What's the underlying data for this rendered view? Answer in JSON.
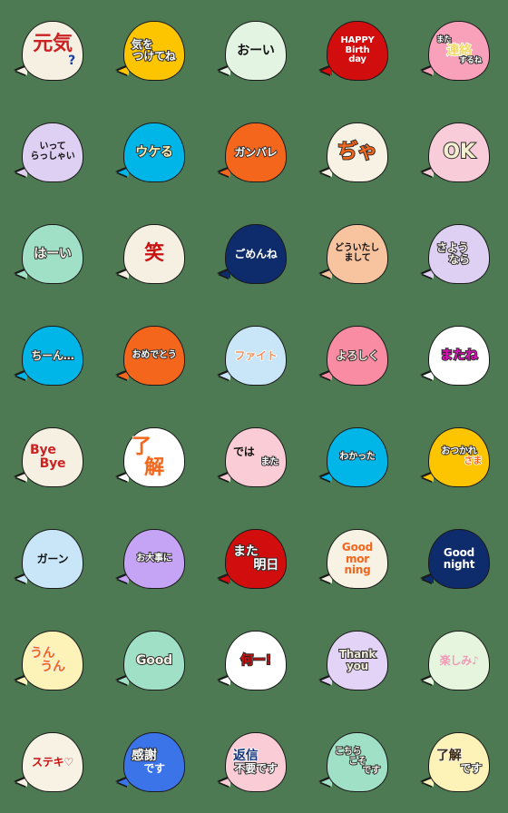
{
  "app": {
    "title": "Speech Bubble Emoji Sticker Sheet",
    "background_color": "#4d7a52",
    "columns": 5,
    "rows": 8
  },
  "stickers": [
    {
      "id": "genki",
      "name": "genki-question",
      "bubble_color": "#f5f0e1",
      "outline": "#1a1a1a",
      "lines": [
        {
          "text": "元気",
          "color": "#cc2222",
          "size": "sz-xl",
          "stroke": "stroke-light"
        },
        {
          "text": "?",
          "color": "#1a3fa0",
          "size": "sz-lg",
          "stroke": "stroke-light",
          "align": "align-r"
        }
      ]
    },
    {
      "id": "kiwotsukete",
      "name": "kiwotsuketene",
      "bubble_color": "#fdc500",
      "outline": "#1a1a1a",
      "lines": [
        {
          "text": "気を",
          "color": "#ffffff",
          "size": "sz-md",
          "stroke": "stroke-dark",
          "align": "align-l"
        },
        {
          "text": "つけてね",
          "color": "#ffffff",
          "size": "sz-md",
          "stroke": "stroke-dark"
        }
      ]
    },
    {
      "id": "ooi",
      "name": "ooi",
      "bubble_color": "#e3f5e2",
      "outline": "#1a1a1a",
      "lines": [
        {
          "text": "おーい",
          "color": "#111111",
          "size": "sz-lg",
          "stroke": "none"
        }
      ]
    },
    {
      "id": "happybirthday",
      "name": "happy-birthday",
      "bubble_color": "#d10d0d",
      "outline": "#1a1a1a",
      "lines": [
        {
          "text": "HAPPY",
          "color": "#ffffff",
          "size": "sz-sm",
          "stroke": "none"
        },
        {
          "text": "Birth",
          "color": "#ffffff",
          "size": "sz-sm",
          "stroke": "none"
        },
        {
          "text": "day",
          "color": "#ffffff",
          "size": "sz-sm",
          "stroke": "none"
        }
      ]
    },
    {
      "id": "renrakusuru",
      "name": "mata-renraku-surune",
      "bubble_color": "#f9a0bb",
      "outline": "#1a1a1a",
      "lines": [
        {
          "text": "また",
          "color": "#ffffff",
          "size": "sz-xs",
          "stroke": "stroke-dark",
          "align": "align-l"
        },
        {
          "text": "連絡",
          "color": "#f0d86a",
          "size": "sz-lg",
          "stroke": "stroke-white"
        },
        {
          "text": "するね",
          "color": "#ffffff",
          "size": "sz-xs",
          "stroke": "stroke-dark",
          "align": "align-r"
        }
      ]
    },
    {
      "id": "itterasshai",
      "name": "itterasshai",
      "bubble_color": "#ded0f2",
      "outline": "#1a1a1a",
      "lines": [
        {
          "text": "いって",
          "color": "#111111",
          "size": "sz-sm",
          "stroke": "none"
        },
        {
          "text": "らっしゃい",
          "color": "#111111",
          "size": "sz-sm",
          "stroke": "none"
        }
      ]
    },
    {
      "id": "ukeru",
      "name": "ukeru",
      "bubble_color": "#00b6e8",
      "outline": "#1a1a1a",
      "lines": [
        {
          "text": "ウケる",
          "color": "#fdf3b8",
          "size": "sz-lg",
          "stroke": "stroke-dark"
        }
      ]
    },
    {
      "id": "ganbare",
      "name": "ganbare",
      "bubble_color": "#f4661c",
      "outline": "#1a1a1a",
      "lines": [
        {
          "text": "ガンバレ",
          "color": "#ffffff",
          "size": "sz-md",
          "stroke": "stroke-dark"
        }
      ]
    },
    {
      "id": "jya",
      "name": "jya",
      "bubble_color": "#f7f2e4",
      "outline": "#1a1a1a",
      "lines": [
        {
          "text": "ぢゃ",
          "color": "#f4661c",
          "size": "sz-xl",
          "stroke": "stroke-dark"
        }
      ]
    },
    {
      "id": "ok",
      "name": "ok",
      "bubble_color": "#f8ccd8",
      "outline": "#1a1a1a",
      "lines": [
        {
          "text": "OK",
          "color": "#f3efd0",
          "size": "sz-xl",
          "stroke": "stroke-dark"
        }
      ]
    },
    {
      "id": "haai",
      "name": "ha-i",
      "bubble_color": "#9fe0c6",
      "outline": "#1a1a1a",
      "lines": [
        {
          "text": "はーい",
          "color": "#f5f2e6",
          "size": "sz-lg",
          "stroke": "stroke-dark"
        }
      ]
    },
    {
      "id": "warai",
      "name": "warai",
      "bubble_color": "#f5f0e1",
      "outline": "#1a1a1a",
      "lines": [
        {
          "text": "笑",
          "color": "#cc1111",
          "size": "sz-xl",
          "stroke": "stroke-light"
        }
      ]
    },
    {
      "id": "gomenne",
      "name": "gomenne",
      "bubble_color": "#0e2b6b",
      "outline": "#1a1a1a",
      "lines": [
        {
          "text": "ごめんね",
          "color": "#ffffff",
          "size": "sz-md",
          "stroke": "none"
        }
      ]
    },
    {
      "id": "douitashimashite",
      "name": "douitashimashite",
      "bubble_color": "#f8c4a0",
      "outline": "#1a1a1a",
      "lines": [
        {
          "text": "どういたし",
          "color": "#111111",
          "size": "sz-sm",
          "stroke": "none",
          "align": "align-l"
        },
        {
          "text": "まして",
          "color": "#111111",
          "size": "sz-sm",
          "stroke": "none"
        }
      ]
    },
    {
      "id": "sayounara",
      "name": "sayounara",
      "bubble_color": "#ddd0f3",
      "outline": "#1a1a1a",
      "lines": [
        {
          "text": "さよう",
          "color": "#f5f0e8",
          "size": "sz-md",
          "stroke": "stroke-dark",
          "align": "align-l"
        },
        {
          "text": "なら",
          "color": "#f5f0e8",
          "size": "sz-md",
          "stroke": "stroke-dark"
        }
      ]
    },
    {
      "id": "chiin",
      "name": "chiin",
      "bubble_color": "#00b6e8",
      "outline": "#1a1a1a",
      "lines": [
        {
          "text": "ちーん…",
          "color": "#f5f0e6",
          "size": "sz-md",
          "stroke": "stroke-dark"
        }
      ]
    },
    {
      "id": "omedetou",
      "name": "omedetou",
      "bubble_color": "#f4661c",
      "outline": "#1a1a1a",
      "lines": [
        {
          "text": "おめでとう",
          "color": "#ffffff",
          "size": "sz-sm",
          "stroke": "stroke-dark"
        }
      ]
    },
    {
      "id": "fight",
      "name": "fight",
      "bubble_color": "#c8e6f8",
      "outline": "#1a1a1a",
      "lines": [
        {
          "text": "ファイト",
          "color": "#f0935e",
          "size": "sz-md",
          "stroke": "stroke-white"
        }
      ]
    },
    {
      "id": "yoroshiku",
      "name": "yoroshiku",
      "bubble_color": "#f98ca2",
      "outline": "#1a1a1a",
      "lines": [
        {
          "text": "よろしく",
          "color": "#f7e9dd",
          "size": "sz-md",
          "stroke": "stroke-dark"
        }
      ]
    },
    {
      "id": "matane",
      "name": "matane",
      "bubble_color": "#ffffff",
      "outline": "#1a1a1a",
      "lines": [
        {
          "text": "またね",
          "color": "#e011bb",
          "size": "sz-lg",
          "stroke": "stroke-dark"
        }
      ]
    },
    {
      "id": "byebye",
      "name": "bye-bye",
      "bubble_color": "#f5f0e1",
      "outline": "#1a1a1a",
      "lines": [
        {
          "text": "Bye",
          "color": "#cc2222",
          "size": "sz-lg",
          "stroke": "stroke-light",
          "align": "align-l"
        },
        {
          "text": "Bye",
          "color": "#cc2222",
          "size": "sz-lg",
          "stroke": "stroke-light"
        }
      ]
    },
    {
      "id": "ryoukai",
      "name": "ryoukai",
      "bubble_color": "#ffffff",
      "outline": "#1a1a1a",
      "lines": [
        {
          "text": "了",
          "color": "#f4661c",
          "size": "sz-xl",
          "stroke": "stroke-light",
          "align": "align-l"
        },
        {
          "text": "解",
          "color": "#f4661c",
          "size": "sz-xl",
          "stroke": "stroke-light"
        }
      ]
    },
    {
      "id": "dewamata",
      "name": "dewa-mata",
      "bubble_color": "#f9ccd6",
      "outline": "#1a1a1a",
      "lines": [
        {
          "text": "では",
          "color": "#111111",
          "size": "sz-md",
          "stroke": "none",
          "align": "align-l"
        },
        {
          "text": "また",
          "color": "#ffffff",
          "size": "sz-sm",
          "stroke": "stroke-dark",
          "align": "align-r"
        }
      ]
    },
    {
      "id": "wakatta",
      "name": "wakatta",
      "bubble_color": "#00b6e8",
      "outline": "#1a1a1a",
      "lines": [
        {
          "text": "わかった",
          "color": "#ffffff",
          "size": "sz-sm",
          "stroke": "stroke-dark"
        }
      ]
    },
    {
      "id": "otsukaresama",
      "name": "otsukaresama",
      "bubble_color": "#fdc500",
      "outline": "#1a1a1a",
      "lines": [
        {
          "text": "おつかれ",
          "color": "#ffffff",
          "size": "sz-sm",
          "stroke": "stroke-dark"
        },
        {
          "text": "さま",
          "color": "#f4661c",
          "size": "sz-sm",
          "stroke": "stroke-white",
          "align": "align-r"
        }
      ]
    },
    {
      "id": "gaan",
      "name": "gaan",
      "bubble_color": "#c8e6f8",
      "outline": "#1a1a1a",
      "lines": [
        {
          "text": "ガーン",
          "color": "#111111",
          "size": "sz-md",
          "stroke": "none"
        }
      ]
    },
    {
      "id": "odaijini",
      "name": "odaijini",
      "bubble_color": "#c5a3f5",
      "outline": "#1a1a1a",
      "lines": [
        {
          "text": "お大事に",
          "color": "#ffffff",
          "size": "sz-sm",
          "stroke": "stroke-dark"
        }
      ]
    },
    {
      "id": "mataashita",
      "name": "mata-ashita",
      "bubble_color": "#d10d0d",
      "outline": "#1a1a1a",
      "lines": [
        {
          "text": "また",
          "color": "#ffffff",
          "size": "sz-lg",
          "stroke": "stroke-dark",
          "align": "align-l"
        },
        {
          "text": "明日",
          "color": "#ffffff",
          "size": "sz-lg",
          "stroke": "stroke-dark",
          "align": "align-r"
        }
      ]
    },
    {
      "id": "goodmorning",
      "name": "good-morning",
      "bubble_color": "#f7f2e4",
      "outline": "#1a1a1a",
      "lines": [
        {
          "text": "Good",
          "color": "#f4661c",
          "size": "sz-md",
          "stroke": "stroke-light"
        },
        {
          "text": "mor",
          "color": "#f4661c",
          "size": "sz-md",
          "stroke": "stroke-light"
        },
        {
          "text": "ning",
          "color": "#f4661c",
          "size": "sz-md",
          "stroke": "stroke-light"
        }
      ]
    },
    {
      "id": "goodnight",
      "name": "good-night",
      "bubble_color": "#0e2b6b",
      "outline": "#1a1a1a",
      "lines": [
        {
          "text": "Good",
          "color": "#ffffff",
          "size": "sz-md",
          "stroke": "none"
        },
        {
          "text": "night",
          "color": "#ffffff",
          "size": "sz-md",
          "stroke": "none"
        }
      ]
    },
    {
      "id": "unun",
      "name": "un-un",
      "bubble_color": "#fdf2b8",
      "outline": "#1a1a1a",
      "lines": [
        {
          "text": "うん",
          "color": "#f4661c",
          "size": "sz-lg",
          "stroke": "stroke-light",
          "align": "align-l"
        },
        {
          "text": "うん",
          "color": "#f4661c",
          "size": "sz-lg",
          "stroke": "stroke-light"
        }
      ]
    },
    {
      "id": "good",
      "name": "good",
      "bubble_color": "#9fe0c6",
      "outline": "#1a1a1a",
      "lines": [
        {
          "text": "Good",
          "color": "#f5f2e6",
          "size": "sz-lg",
          "stroke": "stroke-dark"
        }
      ]
    },
    {
      "id": "naani",
      "name": "nani",
      "bubble_color": "#ffffff",
      "outline": "#1a1a1a",
      "lines": [
        {
          "text": "何ー!",
          "color": "#cc1111",
          "size": "sz-lg",
          "stroke": "stroke-dark"
        }
      ]
    },
    {
      "id": "thankyou",
      "name": "thank-you",
      "bubble_color": "#e3d4f7",
      "outline": "#1a1a1a",
      "lines": [
        {
          "text": "Thank",
          "color": "#f0ead8",
          "size": "sz-md",
          "stroke": "stroke-dark"
        },
        {
          "text": "you",
          "color": "#f0ead8",
          "size": "sz-md",
          "stroke": "stroke-dark"
        }
      ]
    },
    {
      "id": "tanoshimi",
      "name": "tanoshimi",
      "bubble_color": "#e6f5dd",
      "outline": "#1a1a1a",
      "lines": [
        {
          "text": "楽しみ♪",
          "color": "#f299b8",
          "size": "sz-md",
          "stroke": "none"
        }
      ]
    },
    {
      "id": "suteki",
      "name": "suteki-heart",
      "bubble_color": "#f7f2e4",
      "outline": "#1a1a1a",
      "lines": [
        {
          "text": "ステキ♡",
          "color": "#cc1111",
          "size": "sz-md",
          "stroke": "stroke-light"
        }
      ]
    },
    {
      "id": "kansha",
      "name": "kansha-desu",
      "bubble_color": "#3b73e8",
      "outline": "#1a1a1a",
      "lines": [
        {
          "text": "感謝",
          "color": "#ffffff",
          "size": "sz-lg",
          "stroke": "stroke-dark",
          "align": "align-l"
        },
        {
          "text": "です",
          "color": "#ffffff",
          "size": "sz-md",
          "stroke": "none"
        }
      ]
    },
    {
      "id": "henshinfuyou",
      "name": "henshin-fuyou-desu",
      "bubble_color": "#f9ccd6",
      "outline": "#1a1a1a",
      "lines": [
        {
          "text": "返信",
          "color": "#16347a",
          "size": "sz-lg",
          "stroke": "stroke-white",
          "align": "align-l"
        },
        {
          "text": "不要です",
          "color": "#ffffff",
          "size": "sz-md",
          "stroke": "stroke-dark"
        }
      ]
    },
    {
      "id": "kochirakoso",
      "name": "kochirakoso-desu",
      "bubble_color": "#9fe0c6",
      "outline": "#1a1a1a",
      "lines": [
        {
          "text": "こちら",
          "color": "#f5f2e6",
          "size": "sz-sm",
          "stroke": "stroke-dark",
          "align": "align-l"
        },
        {
          "text": "こそ",
          "color": "#f5f2e6",
          "size": "sz-sm",
          "stroke": "stroke-dark"
        },
        {
          "text": "です",
          "color": "#f5f2e6",
          "size": "sz-sm",
          "stroke": "stroke-dark",
          "align": "align-r"
        }
      ]
    },
    {
      "id": "ryoukaidesu",
      "name": "ryoukai-desu",
      "bubble_color": "#fdf2b8",
      "outline": "#1a1a1a",
      "lines": [
        {
          "text": "了解",
          "color": "#3a2a14",
          "size": "sz-lg",
          "stroke": "stroke-light",
          "align": "align-l"
        },
        {
          "text": "です",
          "color": "#ffffff",
          "size": "sz-md",
          "stroke": "stroke-dark",
          "align": "align-r"
        }
      ]
    }
  ]
}
